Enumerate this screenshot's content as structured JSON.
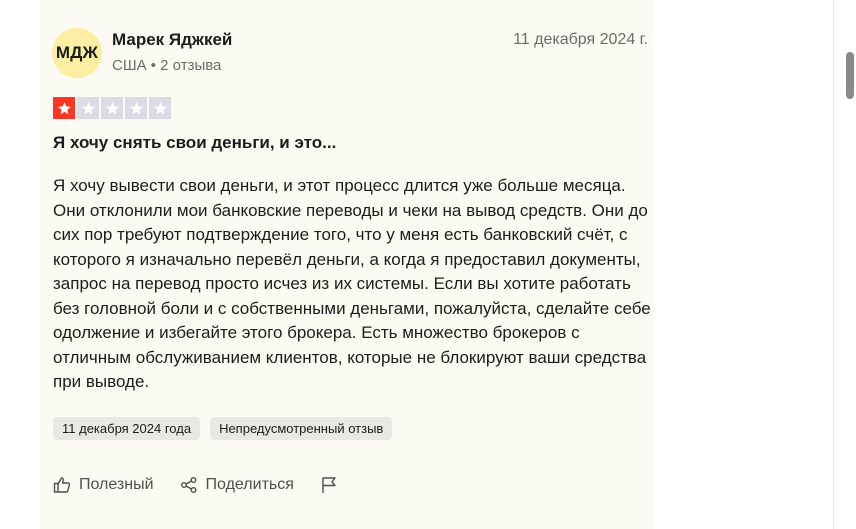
{
  "review": {
    "avatar_initials": "МДЖ",
    "author_name": "Марек Яджкей",
    "author_meta": "США • 2 отзыва",
    "date": "11 декабря 2024 г.",
    "rating": 1,
    "rating_max": 5,
    "title": "Я хочу снять свои деньги, и это...",
    "body": "Я хочу вывести свои деньги, и этот процесс длится уже больше месяца. Они отклонили мои банковские переводы и чеки на вывод средств. Они до сих пор требуют подтверждение того, что у меня есть банковский счёт, с которого я изначально перевёл деньги, а когда я предоставил документы, запрос на перевод просто исчез из их системы. Если вы хотите работать без головной боли и с собственными деньгами, пожалуйста, сделайте себе одолжение и избегайте этого брокера. Есть множество брокеров с отличным обслуживанием клиентов, которые не блокируют ваши средства при выводе.",
    "tags": [
      "11 декабря 2024 года",
      "Непредусмотренный отзыв"
    ]
  },
  "actions": {
    "useful_label": "Полезный",
    "share_label": "Поделиться"
  },
  "colors": {
    "star_filled": "#ff3722",
    "star_empty": "#dcdce6",
    "avatar_bg": "#fcefa1",
    "card_bg": "#fcfbf3"
  },
  "icons": [
    "thumbs-up-icon",
    "share-icon",
    "flag-icon",
    "star-icon"
  ]
}
